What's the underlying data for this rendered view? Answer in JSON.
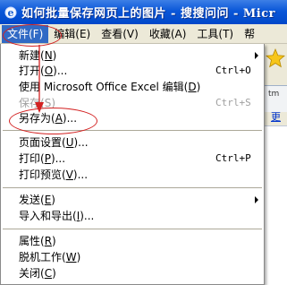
{
  "window": {
    "title": "如何批量保存网页上的图片 - 搜搜问问 - Micr"
  },
  "menubar": [
    {
      "label": "文件(F)",
      "active": true
    },
    {
      "label": "编辑(E)"
    },
    {
      "label": "查看(V)"
    },
    {
      "label": "收藏(A)"
    },
    {
      "label": "工具(T)"
    },
    {
      "label": "帮"
    }
  ],
  "file_menu": {
    "items": [
      {
        "pre": "新建(",
        "acc": "N",
        "post": ")",
        "shortcut": "",
        "submenu": true,
        "disabled": false
      },
      {
        "pre": "打开(",
        "acc": "O",
        "post": ")...",
        "shortcut": "Ctrl+O",
        "submenu": false,
        "disabled": false
      },
      {
        "pre": "使用 Microsoft Office Excel 编辑(",
        "acc": "D",
        "post": ")",
        "shortcut": "",
        "submenu": false,
        "disabled": false
      },
      {
        "pre": "保存(",
        "acc": "S",
        "post": ")",
        "shortcut": "Ctrl+S",
        "submenu": false,
        "disabled": true
      },
      {
        "pre": "另存为(",
        "acc": "A",
        "post": ")...",
        "shortcut": "",
        "submenu": false,
        "disabled": false
      },
      {
        "pre": "页面设置(",
        "acc": "U",
        "post": ")...",
        "shortcut": "",
        "submenu": false,
        "disabled": false
      },
      {
        "pre": "打印(",
        "acc": "P",
        "post": ")...",
        "shortcut": "Ctrl+P",
        "submenu": false,
        "disabled": false
      },
      {
        "pre": "打印预览(",
        "acc": "V",
        "post": ")...",
        "shortcut": "",
        "submenu": false,
        "disabled": false
      },
      {
        "pre": "发送(",
        "acc": "E",
        "post": ")",
        "shortcut": "",
        "submenu": true,
        "disabled": false
      },
      {
        "pre": "导入和导出(",
        "acc": "I",
        "post": ")...",
        "shortcut": "",
        "submenu": false,
        "disabled": false
      },
      {
        "pre": "属性(",
        "acc": "R",
        "post": ")",
        "shortcut": "",
        "submenu": false,
        "disabled": false
      },
      {
        "pre": "脱机工作(",
        "acc": "W",
        "post": ")",
        "shortcut": "",
        "submenu": false,
        "disabled": false
      },
      {
        "pre": "关闭(",
        "acc": "C",
        "post": ")",
        "shortcut": "",
        "submenu": false,
        "disabled": false
      }
    ]
  },
  "background": {
    "fragment_1": "tm",
    "fragment_2": "更"
  },
  "colors": {
    "titlebar": "#0a57d8",
    "menu_highlight": "#316ac5",
    "annotation": "#d32222",
    "disabled_text": "#a0a0a0"
  }
}
